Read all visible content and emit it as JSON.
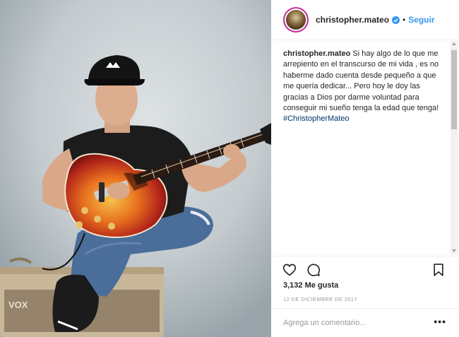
{
  "post": {
    "image_alt": "",
    "amp_logo": "VOX"
  },
  "header": {
    "username": "christopher.mateo",
    "separator": "•",
    "follow_label": "Seguir"
  },
  "caption": {
    "author": "christopher.mateo",
    "text": "Si hay algo de lo que me arrepiento en el transcurso de mi vida , es no haberme dado cuenta desde pequeño a que me quería dedicar... Pero hoy le doy las gracias a Dios por darme voluntad para conseguir mi sueño tenga la edad que tenga!",
    "hashtag": "#ChristopherMateo"
  },
  "stats": {
    "likes": "3,132 Me gusta",
    "date": "12 DE DICIEMBRE DE 2017"
  },
  "comment_box": {
    "placeholder": "Agrega un comentario...",
    "more_label": "•••"
  },
  "icons": {
    "like": "heart-icon",
    "comment": "comment-icon",
    "save": "bookmark-icon",
    "verified": "verified-badge-icon"
  },
  "colors": {
    "link": "#3897f0",
    "hashtag": "#003569",
    "text": "#262626",
    "muted": "#999999",
    "border": "#efefef"
  }
}
